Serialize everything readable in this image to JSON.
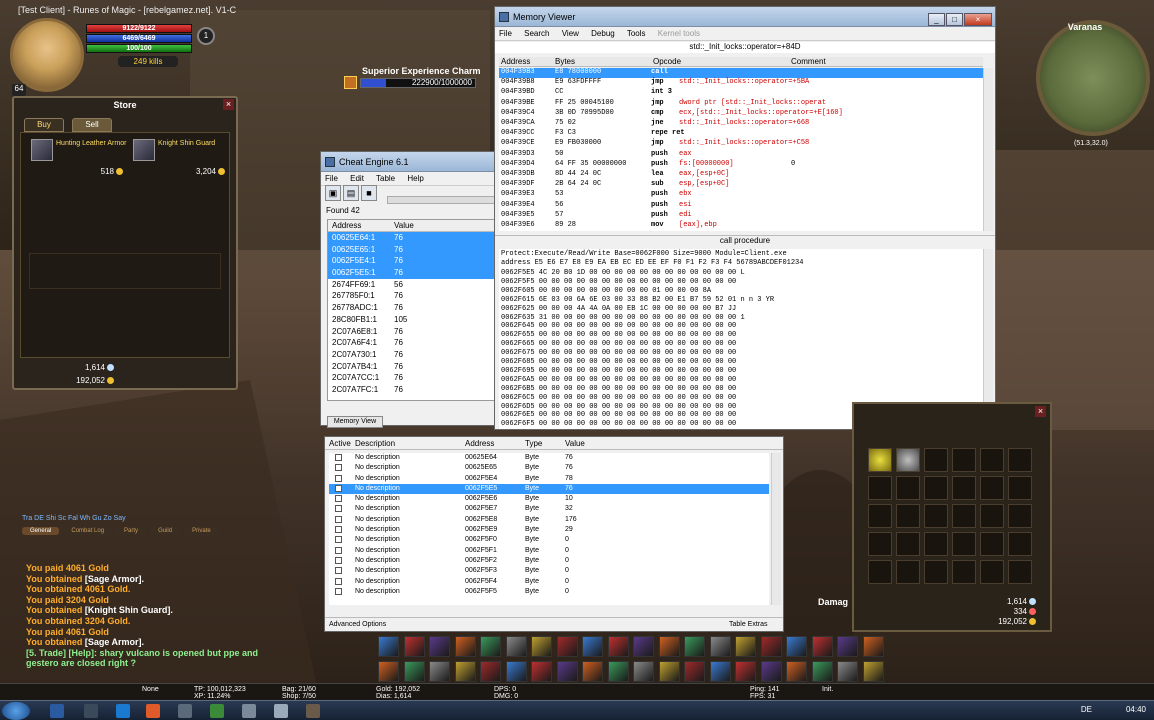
{
  "game": {
    "title": "[Test Client] - Runes of Magic - [rebelgamez.net]. V1-C",
    "hp": "9122/9122",
    "mp": "6469/6469",
    "sp": "100/100",
    "kills": "249 kills",
    "level": "64",
    "circle_num": "1",
    "charm_label": "Superior Experience Charm",
    "charm_value": "222900/1000000",
    "charm_progress": 0.2229,
    "zone": "Varanas",
    "coords": "(51.3,32.0)"
  },
  "store": {
    "title": "Store",
    "tabs": [
      "Buy",
      "Sell"
    ],
    "items": [
      {
        "name": "Hunting Leather Armor",
        "price": "518"
      },
      {
        "name": "Knight Shin Guard",
        "price": "3,204"
      }
    ],
    "money1": "1,614",
    "money2": "192,052"
  },
  "memory_viewer": {
    "title": "Memory Viewer",
    "menu": [
      "File",
      "Search",
      "View",
      "Debug",
      "Tools",
      "Kernel tools"
    ],
    "info": "std::_Init_locks::operator=+84D",
    "columns": [
      "Address",
      "Bytes",
      "Opcode",
      "Comment"
    ],
    "rows": [
      {
        "addr": "004F39B3",
        "bytes": "E8 78000000",
        "op": "call",
        "arg": "",
        "comment": ""
      },
      {
        "addr": "004F39B8",
        "bytes": "E9 63FDFFFF",
        "op": "jmp",
        "arg": "std::_Init_locks::operator=+5BA",
        "comment": ""
      },
      {
        "addr": "004F39BD",
        "bytes": "CC",
        "op": "int 3",
        "arg": "",
        "comment": ""
      },
      {
        "addr": "004F39BE",
        "bytes": "FF 25 00045100",
        "op": "jmp",
        "arg": "dword ptr [std::_Init_locks::operat",
        "comment": ""
      },
      {
        "addr": "004F39C4",
        "bytes": "3B 0D 70995D00",
        "op": "cmp",
        "arg": "ecx,[std::_Init_locks::operator=+E[160]",
        "comment": ""
      },
      {
        "addr": "004F39CA",
        "bytes": "75 02",
        "op": "jne",
        "arg": "std::_Init_locks::operator=+668",
        "comment": ""
      },
      {
        "addr": "004F39CC",
        "bytes": "F3 C3",
        "op": "repe ret",
        "arg": "",
        "comment": ""
      },
      {
        "addr": "004F39CE",
        "bytes": "E9 FB030000",
        "op": "jmp",
        "arg": "std::_Init_locks::operator=+C58",
        "comment": ""
      },
      {
        "addr": "004F39D3",
        "bytes": "50",
        "op": "push",
        "arg": "eax",
        "comment": ""
      },
      {
        "addr": "004F39D4",
        "bytes": "64 FF 35 00000000",
        "op": "push",
        "arg": "fs:[00000000]",
        "comment": "0"
      },
      {
        "addr": "004F39DB",
        "bytes": "8D 44 24 0C",
        "op": "lea",
        "arg": "eax,[esp+0C]",
        "comment": ""
      },
      {
        "addr": "004F39DF",
        "bytes": "2B 64 24 0C",
        "op": "sub",
        "arg": "esp,[esp+0C]",
        "comment": ""
      },
      {
        "addr": "004F39E3",
        "bytes": "53",
        "op": "push",
        "arg": "ebx",
        "comment": ""
      },
      {
        "addr": "004F39E4",
        "bytes": "56",
        "op": "push",
        "arg": "esi",
        "comment": ""
      },
      {
        "addr": "004F39E5",
        "bytes": "57",
        "op": "push",
        "arg": "edi",
        "comment": ""
      },
      {
        "addr": "004F39E6",
        "bytes": "89 28",
        "op": "mov",
        "arg": "[eax],ebp",
        "comment": ""
      }
    ],
    "status": "call procedure",
    "hex_header": "Protect:Execute/Read/Write  Base=0062F000 Size=9000 Module=Client.exe",
    "hex_cols": "address  E5 E6 E7 E8 E9 EA EB EC ED EE EF F0 F1 F2 F3 F4 56789ABCDEF01234",
    "hex_lines": [
      "0062F5E5 4C 20 B0 1D 00 00 00 00 00 00 00 00 00 00 00 00 L",
      "0062F5F5 00 00 00 00 00 00 00 00 00 00 00 00 00 00 00 00",
      "0062F605 00 00 00 00 00 00 00 00 00 01 00 00 00 8A",
      "0062F615 6E 03 00 6A 6E 03 00 33 88 B2 00 E1 B7 59 52 01 n   n   3      YR",
      "0062F625 00 00 00 4A 4A 0A 00 EB 1C 00 00 00 00 00 B7    JJ",
      "0062F635 31 00 00 00 00 00 00 00 00 00 00 00 00 00 00 00 1",
      "0062F645 00 00 00 00 00 00 00 00 00 00 00 00 00 00 00 00",
      "0062F655 00 00 00 00 00 00 00 00 00 00 00 00 00 00 00 00",
      "0062F665 00 00 00 00 00 00 00 00 00 00 00 00 00 00 00 00",
      "0062F675 00 00 00 00 00 00 00 00 00 00 00 00 00 00 00 00",
      "0062F685 00 00 00 00 00 00 00 00 00 00 00 00 00 00 00 00",
      "0062F695 00 00 00 00 00 00 00 00 00 00 00 00 00 00 00 00",
      "0062F6A5 00 00 00 00 00 00 00 00 00 00 00 00 00 00 00 00",
      "0062F6B5 00 00 00 00 00 00 00 00 00 00 00 00 00 00 00 00",
      "0062F6C5 00 00 00 00 00 00 00 00 00 00 00 00 00 00 00 00",
      "0062F6D5 00 00 00 00 00 00 00 00 00 00 00 00 00 00 00 00",
      "0062F6E5 00 00 00 00 00 00 00 00 00 00 00 00 00 00 00 00",
      "0062F6F5 00 00 00 00 00 00 00 00 00 00 00 00 00 00 00 00"
    ]
  },
  "cheat_engine": {
    "title": "Cheat Engine 6.1",
    "menu": [
      "File",
      "Edit",
      "Table",
      "Help"
    ],
    "found": "Found 42",
    "columns": [
      "Address",
      "Value"
    ],
    "rows": [
      {
        "addr": "00625E64:1",
        "val": "76"
      },
      {
        "addr": "00625E65:1",
        "val": "76"
      },
      {
        "addr": "0062F5E4:1",
        "val": "76"
      },
      {
        "addr": "0062F5E5:1",
        "val": "76"
      },
      {
        "addr": "2674FF69:1",
        "val": "56"
      },
      {
        "addr": "267785F0:1",
        "val": "76"
      },
      {
        "addr": "26778ADC:1",
        "val": "76"
      },
      {
        "addr": "28C80FB1:1",
        "val": "105"
      },
      {
        "addr": "2C07A6E8:1",
        "val": "76"
      },
      {
        "addr": "2C07A6F4:1",
        "val": "76"
      },
      {
        "addr": "2C07A730:1",
        "val": "76"
      },
      {
        "addr": "2C07A7B4:1",
        "val": "76"
      },
      {
        "addr": "2C07A7CC:1",
        "val": "76"
      },
      {
        "addr": "2C07A7FC:1",
        "val": "76"
      }
    ],
    "memory_view_btn": "Memory View",
    "table_columns": [
      "Active",
      "Description",
      "Address",
      "Type",
      "Value"
    ],
    "table_rows": [
      {
        "desc": "No description",
        "addr": "00625E64",
        "type": "Byte",
        "val": "76"
      },
      {
        "desc": "No description",
        "addr": "00625E65",
        "type": "Byte",
        "val": "76"
      },
      {
        "desc": "No description",
        "addr": "0062F5E4",
        "type": "Byte",
        "val": "78"
      },
      {
        "desc": "No description",
        "addr": "0062F5E5",
        "type": "Byte",
        "val": "76"
      },
      {
        "desc": "No description",
        "addr": "0062F5E6",
        "type": "Byte",
        "val": "10"
      },
      {
        "desc": "No description",
        "addr": "0062F5E7",
        "type": "Byte",
        "val": "32"
      },
      {
        "desc": "No description",
        "addr": "0062F5E8",
        "type": "Byte",
        "val": "176"
      },
      {
        "desc": "No description",
        "addr": "0062F5E9",
        "type": "Byte",
        "val": "29"
      },
      {
        "desc": "No description",
        "addr": "0062F5F0",
        "type": "Byte",
        "val": "0"
      },
      {
        "desc": "No description",
        "addr": "0062F5F1",
        "type": "Byte",
        "val": "0"
      },
      {
        "desc": "No description",
        "addr": "0062F5F2",
        "type": "Byte",
        "val": "0"
      },
      {
        "desc": "No description",
        "addr": "0062F5F3",
        "type": "Byte",
        "val": "0"
      },
      {
        "desc": "No description",
        "addr": "0062F5F4",
        "type": "Byte",
        "val": "0"
      },
      {
        "desc": "No description",
        "addr": "0062F5F5",
        "type": "Byte",
        "val": "0"
      }
    ],
    "advanced": "Advanced Options",
    "extras": "Table Extras"
  },
  "chat": {
    "tabs_line": "Tra DE Shi Sc Fal Wh Gu Zo Say",
    "tabs": [
      "General",
      "Combat Log",
      "Party",
      "Guild",
      "Private"
    ],
    "lines": [
      {
        "text": "You paid 4061 Gold",
        "item": "",
        "kind": "sys"
      },
      {
        "text": "You obtained ",
        "item": "[Sage Armor].",
        "kind": "sys"
      },
      {
        "text": "You obtained 4061 Gold.",
        "item": "",
        "kind": "sys"
      },
      {
        "text": "You paid 3204 Gold",
        "item": "",
        "kind": "sys"
      },
      {
        "text": "You obtained ",
        "item": "[Knight Shin Guard].",
        "kind": "sys"
      },
      {
        "text": "You obtained 3204 Gold.",
        "item": "",
        "kind": "sys"
      },
      {
        "text": "You paid 4061 Gold",
        "item": "",
        "kind": "sys"
      },
      {
        "text": "You obtained ",
        "item": "[Sage Armor].",
        "kind": "sys"
      },
      {
        "text": "[5. Trade] [Help]: shary vulcano is opened but ppe and",
        "item": "",
        "kind": "trade"
      },
      {
        "text": "gestero are closed right ?",
        "item": "",
        "kind": "trade"
      }
    ]
  },
  "bag": {
    "money1": "1,614",
    "money2": "334",
    "money3": "192,052",
    "damage_label": "Damag"
  },
  "statusbar": {
    "none": "None",
    "tp": "TP: 100,012,323",
    "xp": "XP: 11.24%",
    "bag": "Bag: 21/60",
    "shop": "Shop: 7/50",
    "gold": "Gold: 192,052",
    "dias": "Dias: 1,614",
    "dps": "DPS: 0",
    "dmg": "DMG: 0",
    "ping": "Ping: 141",
    "fps": "FPS: 31",
    "init": "Init."
  },
  "taskbar": {
    "lang": "DE",
    "time": "04:40"
  }
}
